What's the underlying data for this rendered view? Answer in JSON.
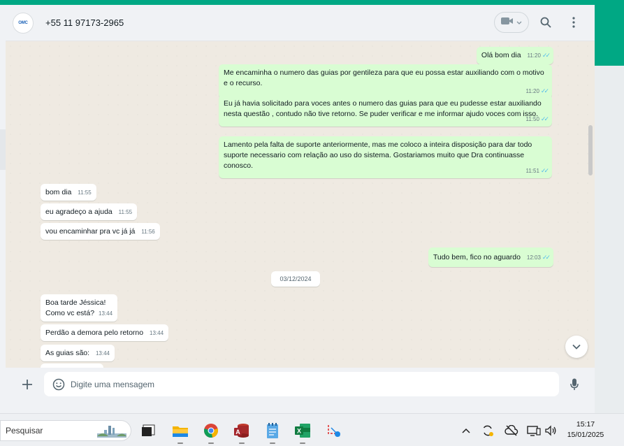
{
  "header": {
    "contact_name": "+55 11 97173-2965",
    "avatar_label": "OMC"
  },
  "messages": {
    "outgoing": [
      {
        "text": "Olá bom dia",
        "time": "11:20"
      },
      {
        "text": "Me encaminha o numero das guias por gentileza para que eu possa estar auxiliando com o motivo e o recurso.",
        "time": "11:20"
      },
      {
        "text": "Eu já havia solicitado para voces antes o numero das guias para que eu pudesse estar auxiliando nesta questão , contudo não tive retorno. Se puder verificar e me informar ajudo voces com isso.",
        "time": "11:50"
      },
      {
        "text": "Lamento pela falta de suporte anteriormente, mas me coloco a inteira disposição para dar todo suporte necessario com relação ao uso do sistema. Gostariamos muito que Dra continuasse conosco.",
        "time": "11:51"
      },
      {
        "text": "Tudo bem, fico no aguardo",
        "time": "12:03"
      }
    ],
    "incoming": [
      {
        "text": "bom dia",
        "time": "11:55"
      },
      {
        "text": "eu agradeço a ajuda",
        "time": "11:55"
      },
      {
        "text": "vou encaminhar pra vc já já",
        "time": "11:56"
      },
      {
        "line1": "Boa tarde Jéssica!",
        "line2": "Como vc está?",
        "time": "13:44"
      },
      {
        "text": "Perdão a demora pelo retorno",
        "time": "13:44"
      },
      {
        "text": "As guias são:",
        "time": "13:44"
      }
    ],
    "date_separator": "03/12/2024"
  },
  "composer": {
    "placeholder": "Digite uma mensagem"
  },
  "taskbar": {
    "search_placeholder": "Pesquisar",
    "time": "15:17",
    "date": "15/01/2025"
  },
  "colors": {
    "accent": "#00a884",
    "outgoing_bubble": "#d9fdd3",
    "incoming_bubble": "#ffffff",
    "read_ticks": "#53bdeb"
  }
}
